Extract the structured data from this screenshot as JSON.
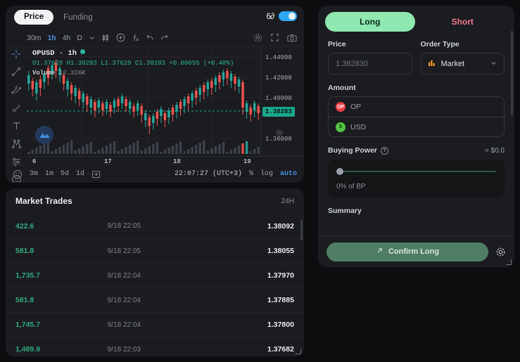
{
  "chart": {
    "tabs": [
      {
        "label": "Price",
        "active": true
      },
      {
        "label": "Funding",
        "active": false
      }
    ],
    "glasses_icon": "glasses-icon",
    "toggle_on": true,
    "timeframes": [
      {
        "label": "30m",
        "active": false
      },
      {
        "label": "1h",
        "active": true
      },
      {
        "label": "4h",
        "active": false
      },
      {
        "label": "D",
        "active": false
      }
    ],
    "toolbar_icons": [
      "chevron-down-icon",
      "candlestick-icon",
      "add-indicator-icon",
      "fx-icon",
      "undo-icon",
      "redo-icon"
    ],
    "toolbar_right_icons": [
      "gear-icon",
      "fullscreen-icon",
      "camera-icon"
    ],
    "draw_tools": [
      "crosshair-icon",
      "trendline-icon",
      "fork-icon",
      "brush-icon",
      "text-icon",
      "pattern-icon",
      "settings-sliders-icon",
      "emoji-icon"
    ],
    "symbol": "OPUSD · 1h",
    "ohlc": "O1.37628 H1.38283 L1.37628 C1.38283 +0.00655 (+0.48%)",
    "volume_label": "Volume",
    "volume_value": "12.326K",
    "price_ticks": [
      "1.44000",
      "1.42000",
      "1.40000",
      "1.36000"
    ],
    "current_price": "1.38283",
    "time_ticks": [
      "6",
      "17",
      "18",
      "19"
    ],
    "foot_timeframes": [
      "3m",
      "1m",
      "5d",
      "1d"
    ],
    "foot_calendar_icon": "calendar-icon",
    "clock": "22:07:27 (UTC+3)",
    "foot_options": [
      {
        "label": "%",
        "active": false
      },
      {
        "label": "log",
        "active": false
      },
      {
        "label": "auto",
        "active": true
      }
    ],
    "colors": {
      "up": "#26a69a",
      "down": "#ef5350",
      "accent_blue": "#4a90e2",
      "price_badge": "#1aa68b"
    }
  },
  "trades": {
    "title": "Market Trades",
    "period": "24H",
    "rows": [
      {
        "size": "422.6",
        "time": "9/18 22:05",
        "price": "1.38092"
      },
      {
        "size": "581.8",
        "time": "9/18 22:05",
        "price": "1.38055"
      },
      {
        "size": "1,735.7",
        "time": "9/18 22:04",
        "price": "1.37970"
      },
      {
        "size": "581.8",
        "time": "9/18 22:04",
        "price": "1.37885"
      },
      {
        "size": "1,745.7",
        "time": "9/18 22:04",
        "price": "1.37800"
      },
      {
        "size": "1,489.9",
        "time": "9/18 22:03",
        "price": "1.37682"
      }
    ]
  },
  "order": {
    "side_tabs": [
      {
        "label": "Long",
        "active": true
      },
      {
        "label": "Short",
        "active": false
      }
    ],
    "price_label": "Price",
    "price_value": "1.382830",
    "order_type_label": "Order Type",
    "order_type_value": "Market",
    "order_type_icon": "bars-icon",
    "amount_label": "Amount",
    "amount_rows": [
      {
        "symbol": "OP",
        "icon": "op-token-icon"
      },
      {
        "symbol": "USD",
        "icon": "usd-token-icon"
      }
    ],
    "buying_power_label": "Buying Power",
    "buying_power_value": "≈ $0.0",
    "slider_percent": 0,
    "slider_text": "0% of BP",
    "summary_label": "Summary",
    "confirm_label": "Confirm Long",
    "confirm_icon": "arrow-up-right-icon",
    "settings_icon": "gear-icon"
  }
}
